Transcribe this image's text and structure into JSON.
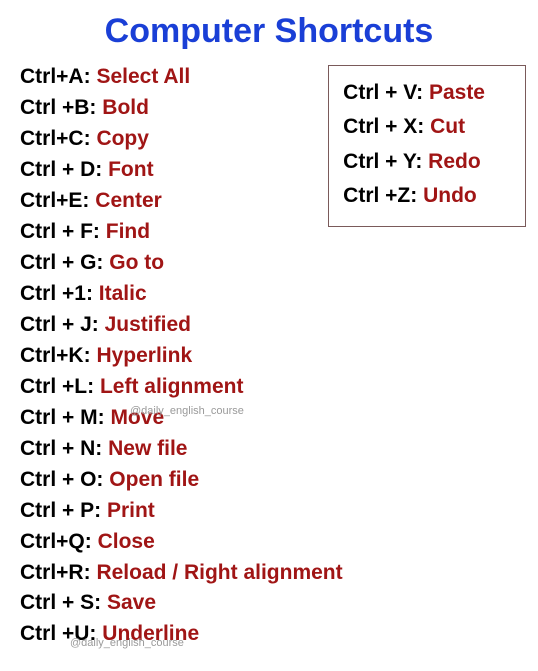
{
  "title": "Computer Shortcuts",
  "left": [
    {
      "key": "Ctrl+A:",
      "action": "Select All"
    },
    {
      "key": "Ctrl +B:",
      "action": "Bold"
    },
    {
      "key": "Ctrl+C:",
      "action": "Copy"
    },
    {
      "key": "Ctrl + D:",
      "action": "Font"
    },
    {
      "key": "Ctrl+E:",
      "action": "Center"
    },
    {
      "key": "Ctrl + F:",
      "action": "Find"
    },
    {
      "key": "Ctrl + G:",
      "action": "Go to"
    },
    {
      "key": "Ctrl +1:",
      "action": "Italic"
    },
    {
      "key": "Ctrl + J:",
      "action": "Justified"
    },
    {
      "key": "Ctrl+K:",
      "action": "Hyperlink"
    },
    {
      "key": "Ctrl +L:",
      "action": "Left alignment"
    },
    {
      "key": "Ctrl + M:",
      "action": "Move"
    },
    {
      "key": "Ctrl + N:",
      "action": "New file"
    },
    {
      "key": "Ctrl + O:",
      "action": "Open file"
    },
    {
      "key": "Ctrl + P:",
      "action": "Print"
    },
    {
      "key": "Ctrl+Q:",
      "action": "Close"
    },
    {
      "key": "Ctrl+R:",
      "action": "Reload / Right alignment"
    },
    {
      "key": "Ctrl + S:",
      "action": "Save"
    },
    {
      "key": "Ctrl +U:",
      "action": "Underline"
    }
  ],
  "box": [
    {
      "key": "Ctrl + V:",
      "action": "Paste"
    },
    {
      "key": "Ctrl + X:",
      "action": "Cut"
    },
    {
      "key": "Ctrl + Y:",
      "action": "Redo"
    },
    {
      "key": "Ctrl +Z:",
      "action": "Undo"
    }
  ],
  "watermark": "@daily_english_course"
}
